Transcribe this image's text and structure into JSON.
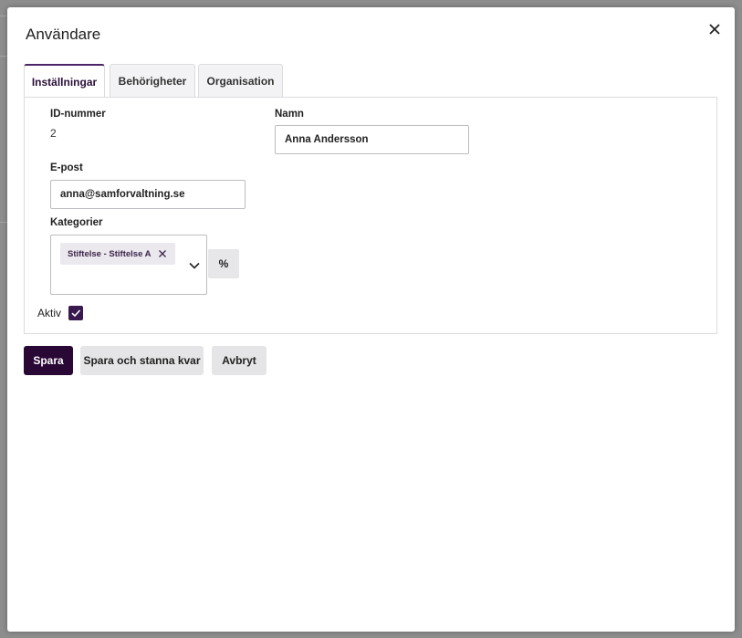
{
  "modal": {
    "title": "Användare",
    "close_icon": "close-icon"
  },
  "tabs": [
    {
      "label": "Inställningar",
      "active": true
    },
    {
      "label": "Behörigheter",
      "active": false
    },
    {
      "label": "Organisation",
      "active": false
    }
  ],
  "form": {
    "id_label": "ID-nummer",
    "id_value": "2",
    "name_label": "Namn",
    "name_value": "Anna Andersson",
    "email_label": "E-post",
    "email_value": "anna@samforvaltning.se",
    "categories_label": "Kategorier",
    "categories_selected": [
      "Stiftelse - Stiftelse A"
    ],
    "percent_label": "%",
    "active_label": "Aktiv",
    "active_checked": true
  },
  "actions": {
    "save": "Spara",
    "save_stay": "Spara och stanna kvar",
    "cancel": "Avbryt"
  },
  "colors": {
    "primary": "#2a0836",
    "accent": "#4b2566",
    "chip_bg": "#ebe8ee"
  }
}
